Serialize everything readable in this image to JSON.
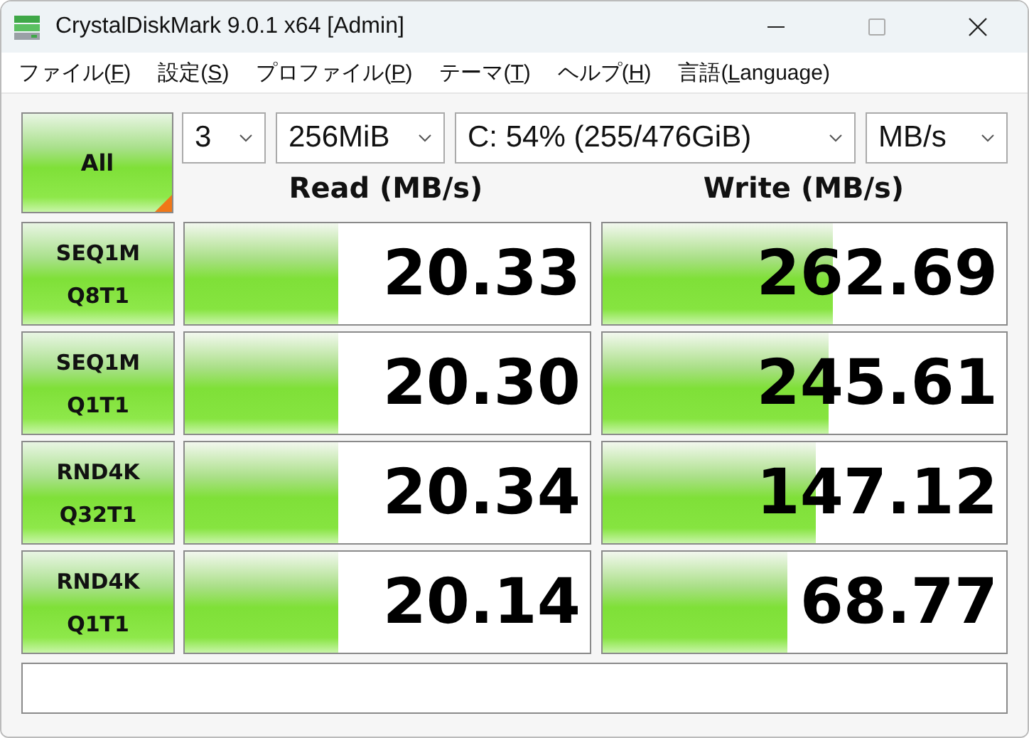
{
  "window": {
    "title": "CrystalDiskMark 9.0.1 x64 [Admin]"
  },
  "menu": [
    {
      "before": "ファイル(",
      "key": "F",
      "after": ")"
    },
    {
      "before": "設定(",
      "key": "S",
      "after": ")"
    },
    {
      "before": "プロファイル(",
      "key": "P",
      "after": ")"
    },
    {
      "before": "テーマ(",
      "key": "T",
      "after": ")"
    },
    {
      "before": "ヘルプ(",
      "key": "H",
      "after": ")"
    },
    {
      "before": "言語(",
      "key": "L",
      "after": "anguage)"
    }
  ],
  "all_button": "All",
  "selectors": [
    {
      "value": "3"
    },
    {
      "value": "256MiB"
    },
    {
      "value": "C: 54% (255/476GiB)"
    },
    {
      "value": "MB/s"
    }
  ],
  "headers": {
    "read": "Read (MB/s)",
    "write": "Write (MB/s)"
  },
  "tests": [
    {
      "line1": "SEQ1M",
      "line2": "Q8T1",
      "read": {
        "value": "20.33",
        "level": 0.38
      },
      "write": {
        "value": "262.69",
        "level": 0.57
      }
    },
    {
      "line1": "SEQ1M",
      "line2": "Q1T1",
      "read": {
        "value": "20.30",
        "level": 0.38
      },
      "write": {
        "value": "245.61",
        "level": 0.56
      }
    },
    {
      "line1": "RND4K",
      "line2": "Q32T1",
      "read": {
        "value": "20.34",
        "level": 0.38
      },
      "write": {
        "value": "147.12",
        "level": 0.53
      }
    },
    {
      "line1": "RND4K",
      "line2": "Q1T1",
      "read": {
        "value": "20.14",
        "level": 0.38
      },
      "write": {
        "value": "68.77",
        "level": 0.46
      }
    }
  ]
}
